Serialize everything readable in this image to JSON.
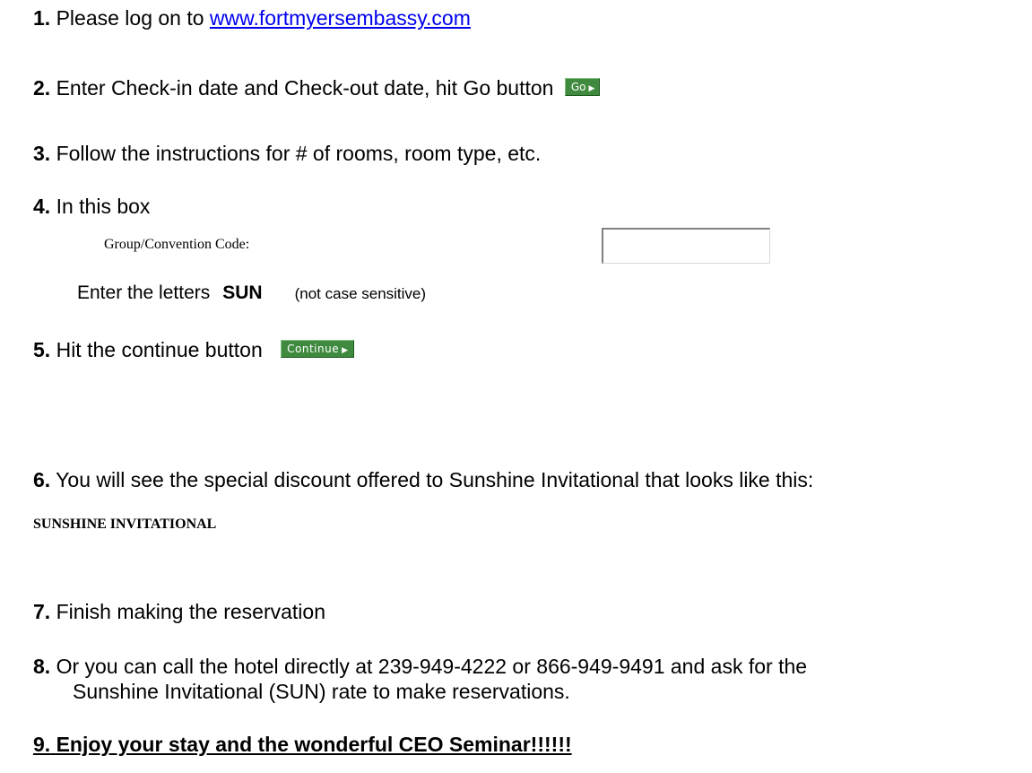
{
  "steps": [
    {
      "num": "1.",
      "text": "Please log on to ",
      "link": "www.fortmyersembassy.com"
    },
    {
      "num": "2.",
      "text": "Enter Check-in date and Check-out date, hit Go button",
      "button": "Go"
    },
    {
      "num": "3.",
      "text": "Follow the instructions for # of rooms, room type, etc."
    },
    {
      "num": "4.",
      "text": "In this box"
    },
    {
      "num": "5.",
      "text": "Hit the continue button",
      "button": "Continue"
    },
    {
      "num": "6.",
      "text": "You will see the special discount offered to Sunshine Invitational  that looks like this:"
    },
    {
      "num": "7.",
      "text": "Finish making the reservation"
    },
    {
      "num": "8.",
      "line1": "Or you can call the hotel directly at 239-949-4222 or 866-949-9491 and ask for the",
      "line2": "Sunshine Invitational (SUN) rate to make reservations."
    },
    {
      "num": "9.",
      "text": "Enjoy your stay and the wonderful CEO Seminar!!!!!!"
    }
  ],
  "group_code": {
    "label": "Group/Convention Code:",
    "value": ""
  },
  "enter_line": {
    "prefix": "Enter the letters",
    "code": "SUN",
    "note": "(not case sensitive)"
  },
  "discount_example": "SUNSHINE INVITATIONAL",
  "colors": {
    "link": "#0000ee",
    "button_bg": "#3f8a3f"
  }
}
